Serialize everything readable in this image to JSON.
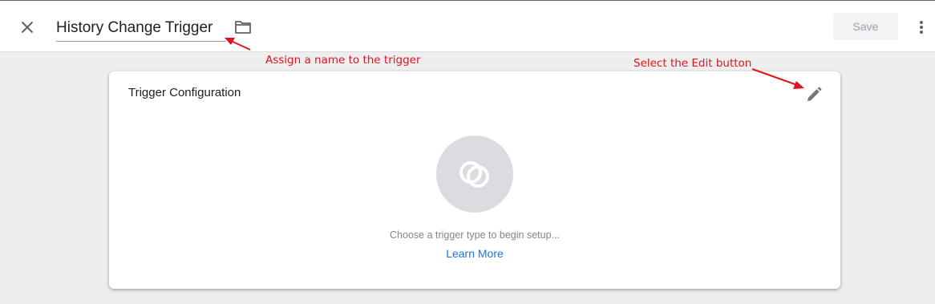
{
  "header": {
    "trigger_name": "History Change Trigger",
    "save_label": "Save",
    "icons": {
      "close": "close-icon",
      "folder": "folder-icon",
      "more": "more-vert-icon"
    }
  },
  "card": {
    "title": "Trigger Configuration",
    "edit_icon": "pencil-icon",
    "type_icon": "trigger-circles-icon",
    "hint": "Choose a trigger type to begin setup...",
    "learn_more": "Learn More"
  },
  "annotations": {
    "name_note": "Assign a name to the trigger",
    "edit_note": "Select the Edit button"
  },
  "colors": {
    "accent_link": "#1a73e8",
    "annotation": "#e0141e",
    "background": "#eeeeee"
  }
}
